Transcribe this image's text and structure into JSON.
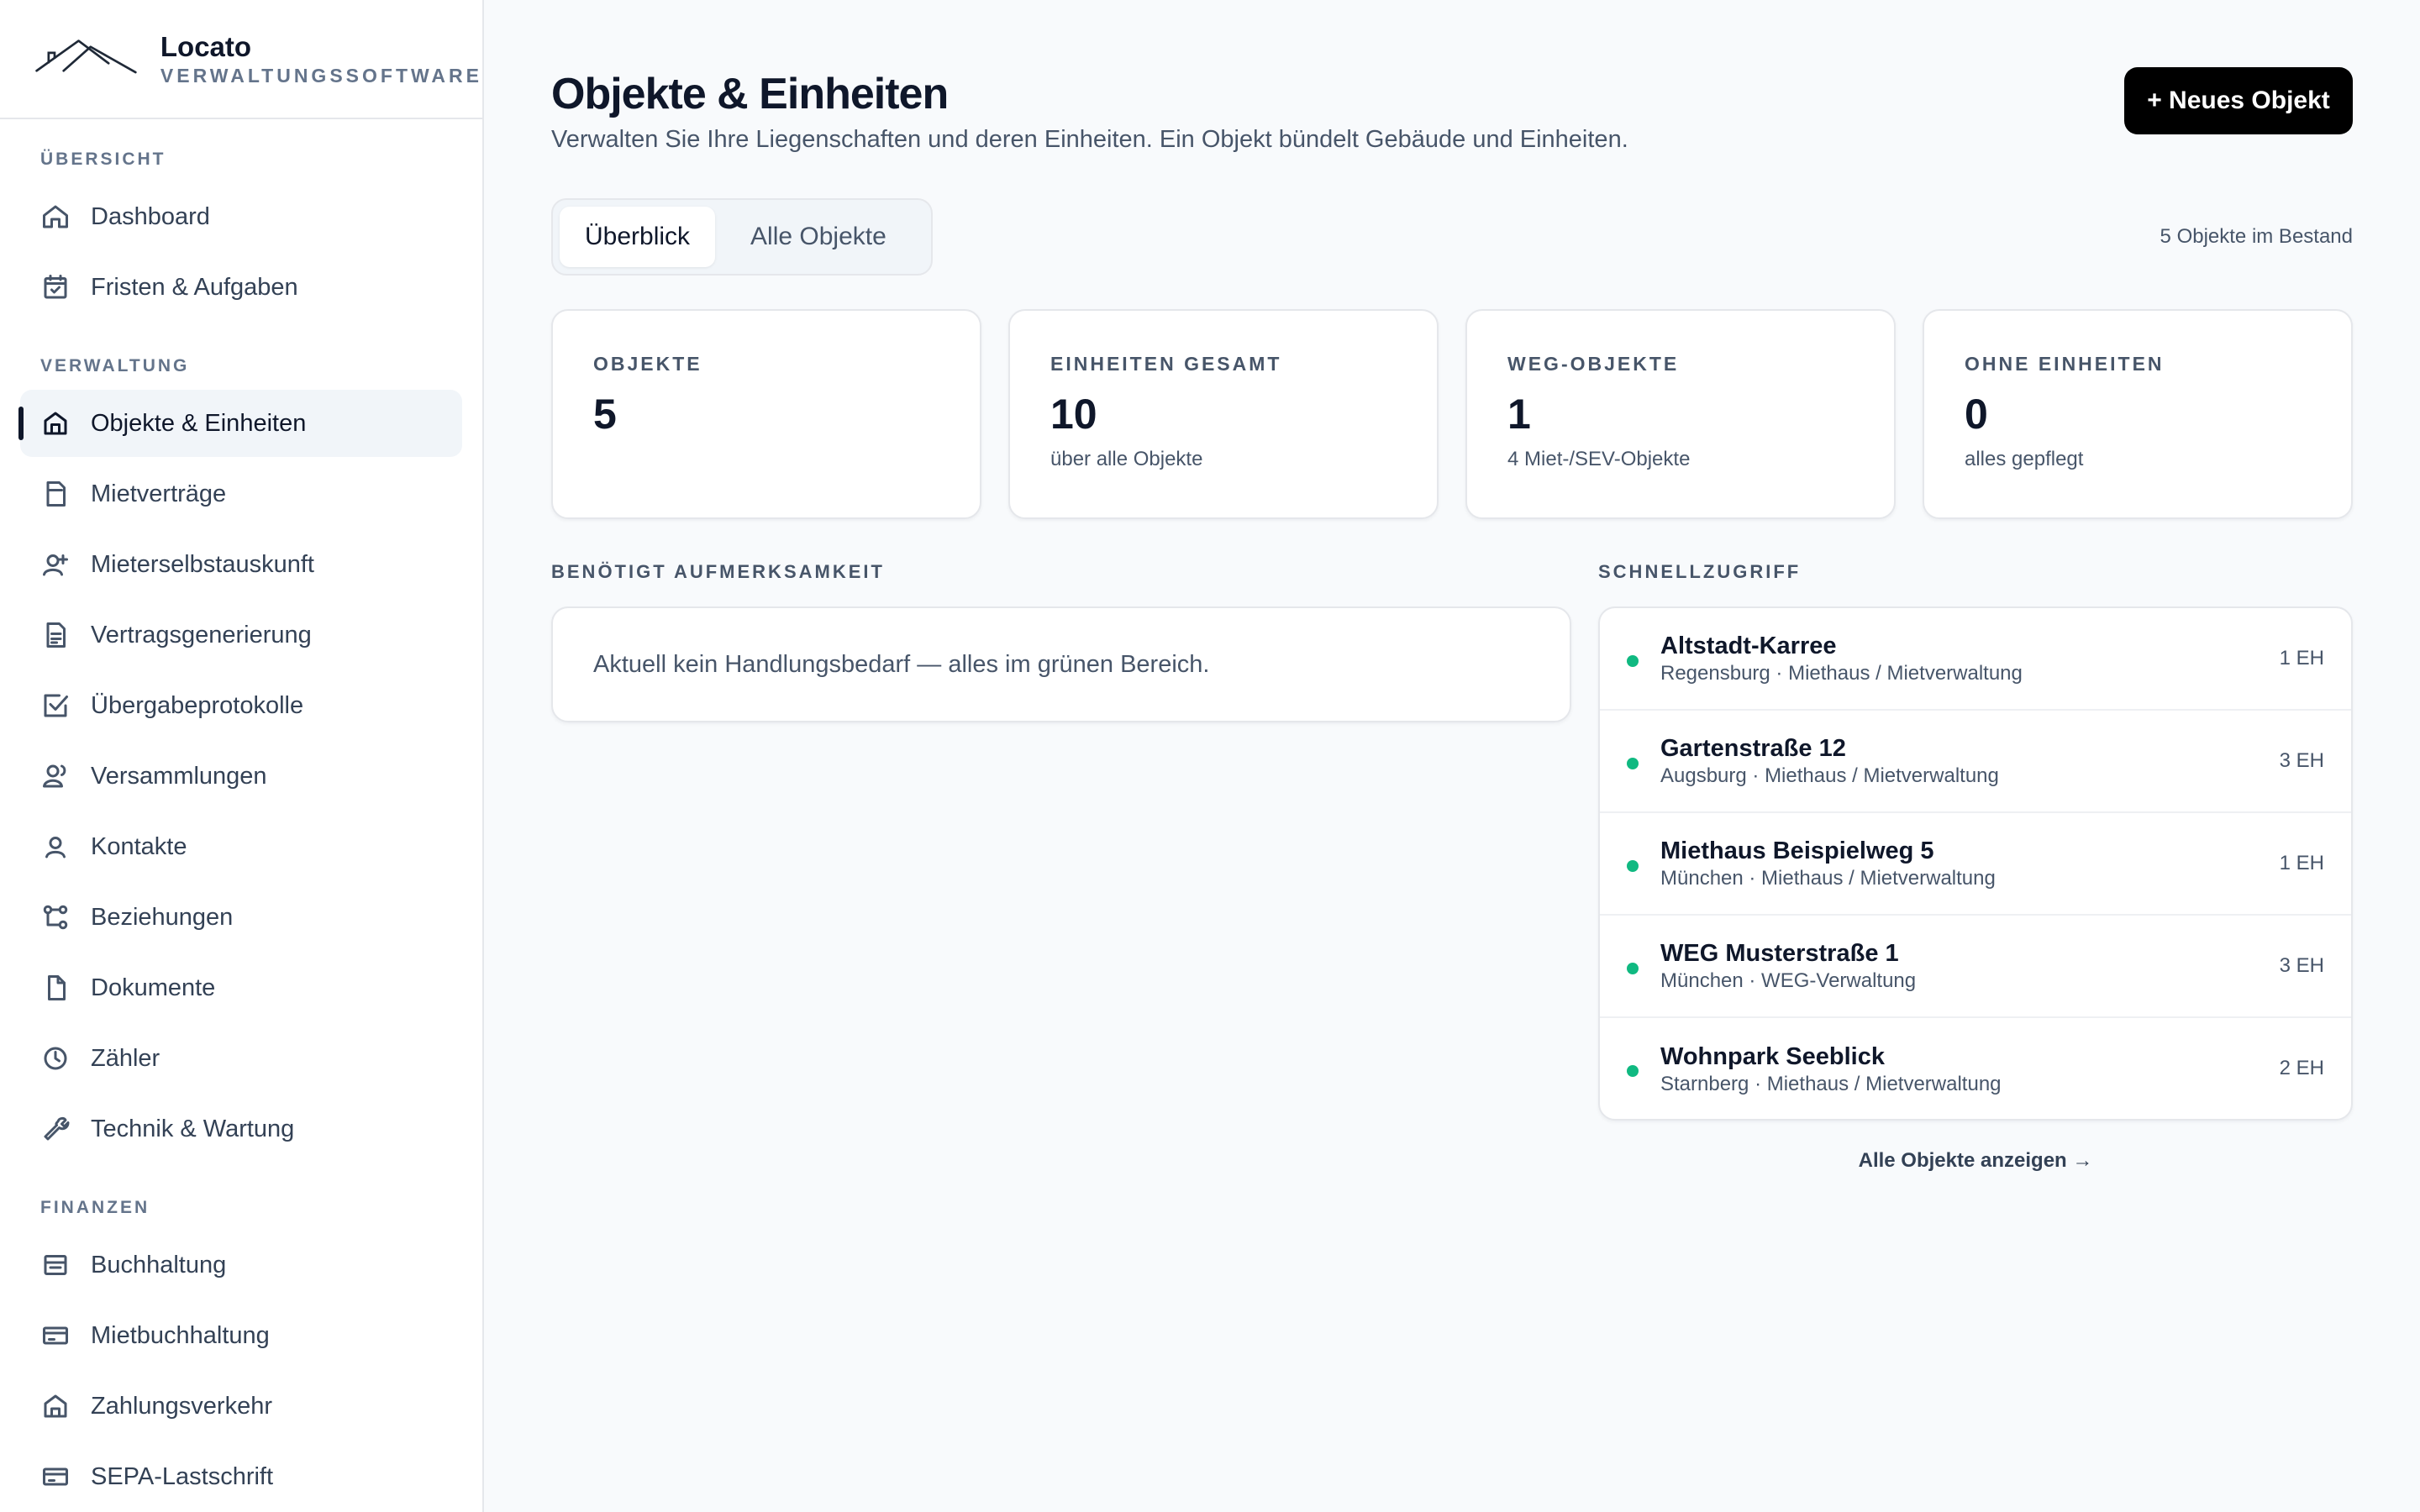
{
  "brand": {
    "name": "Locato",
    "subtitle": "VERWALTUNGSSOFTWARE"
  },
  "sidebar": {
    "sections": [
      {
        "label": "ÜBERSICHT"
      },
      {
        "label": "VERWALTUNG"
      },
      {
        "label": "FINANZEN"
      }
    ],
    "items": [
      {
        "label": "Dashboard",
        "icon": "home-icon"
      },
      {
        "label": "Fristen & Aufgaben",
        "icon": "calendar-check-icon"
      },
      {
        "label": "Objekte & Einheiten",
        "icon": "building-icon",
        "active": true
      },
      {
        "label": "Mietverträge",
        "icon": "contract-icon"
      },
      {
        "label": "Mieterselbstauskunft",
        "icon": "user-plus-icon"
      },
      {
        "label": "Vertragsgenerierung",
        "icon": "document-text-icon"
      },
      {
        "label": "Übergabeprotokolle",
        "icon": "checkbox-icon"
      },
      {
        "label": "Versammlungen",
        "icon": "users-icon"
      },
      {
        "label": "Kontakte",
        "icon": "user-icon"
      },
      {
        "label": "Beziehungen",
        "icon": "relations-icon"
      },
      {
        "label": "Dokumente",
        "icon": "file-icon"
      },
      {
        "label": "Zähler",
        "icon": "clock-icon"
      },
      {
        "label": "Technik & Wartung",
        "icon": "wrench-icon"
      },
      {
        "label": "Buchhaltung",
        "icon": "ledger-icon"
      },
      {
        "label": "Mietbuchhaltung",
        "icon": "card-icon"
      },
      {
        "label": "Zahlungsverkehr",
        "icon": "bank-icon"
      },
      {
        "label": "SEPA-Lastschrift",
        "icon": "card-icon"
      }
    ]
  },
  "header": {
    "title": "Objekte & Einheiten",
    "description": "Verwalten Sie Ihre Liegenschaften und deren Einheiten. Ein Objekt bündelt Gebäude und Einheiten.",
    "new_button": "+ Neues Objekt"
  },
  "tabs": [
    {
      "label": "Überblick",
      "active": true
    },
    {
      "label": "Alle Objekte",
      "active": false
    }
  ],
  "count_note": "5 Objekte im Bestand",
  "stats": [
    {
      "label": "OBJEKTE",
      "value": "5",
      "sub": ""
    },
    {
      "label": "EINHEITEN GESAMT",
      "value": "10",
      "sub": "über alle Objekte"
    },
    {
      "label": "WEG-OBJEKTE",
      "value": "1",
      "sub": "4 Miet-/SEV-Objekte"
    },
    {
      "label": "OHNE EINHEITEN",
      "value": "0",
      "sub": "alles gepflegt"
    }
  ],
  "attention": {
    "label": "BENÖTIGT AUFMERKSAMKEIT",
    "message": "Aktuell kein Handlungsbedarf — alles im grünen Bereich."
  },
  "quick_access": {
    "label": "SCHNELLZUGRIFF",
    "items": [
      {
        "name": "Altstadt-Karree",
        "meta": "Regensburg · Miethaus / Mietverwaltung",
        "units": "1 EH"
      },
      {
        "name": "Gartenstraße 12",
        "meta": "Augsburg · Miethaus / Mietverwaltung",
        "units": "3 EH"
      },
      {
        "name": "Miethaus Beispielweg 5",
        "meta": "München · Miethaus / Mietverwaltung",
        "units": "1 EH"
      },
      {
        "name": "WEG Musterstraße 1",
        "meta": "München · WEG-Verwaltung",
        "units": "3 EH"
      },
      {
        "name": "Wohnpark Seeblick",
        "meta": "Starnberg · Miethaus / Mietverwaltung",
        "units": "2 EH"
      }
    ],
    "show_all": "Alle Objekte anzeigen →",
    "status_color": "#10b981"
  }
}
